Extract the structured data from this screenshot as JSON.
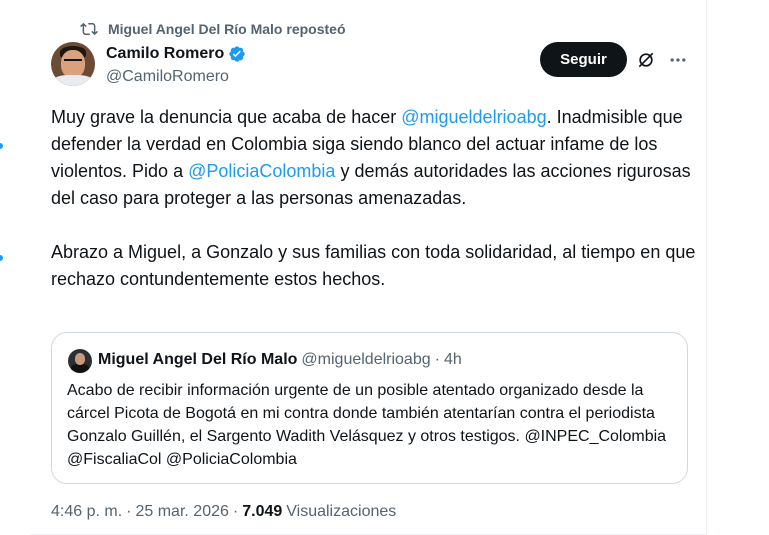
{
  "repost": {
    "text": "Miguel Angel Del Río Malo reposteó",
    "icon": "repost-icon"
  },
  "author": {
    "name": "Camilo Romero",
    "handle": "@CamiloRomero",
    "verified": true
  },
  "actions": {
    "follow_label": "Seguir",
    "grok_icon": "grok-icon",
    "more_icon": "more-icon"
  },
  "tweet": {
    "p1_a": "Muy grave la denuncia que acaba de hacer ",
    "p1_mention1": "@migueldelrioabg",
    "p1_b": ". Inadmisible que defender la verdad en Colombia siga siendo blanco del actuar infame de los violentos. Pido a ",
    "p1_mention2": "@PoliciaColombia",
    "p1_c": " y demás autoridades las acciones rigurosas del caso para proteger a las personas amenazadas.",
    "p2": "Abrazo a Miguel, a Gonzalo y sus familias con toda solidaridad, al tiempo en que rechazo contundentemente estos hechos."
  },
  "quote": {
    "name": "Miguel Angel Del Río Malo",
    "handle": "@migueldelrioabg",
    "separator": "·",
    "time": "4h",
    "text": "Acabo de recibir información urgente de un posible atentado organizado desde la cárcel Picota de Bogotá en mi contra donde también atentarían contra el periodista Gonzalo Guillén, el Sargento Wadith Velásquez y otros testigos. @INPEC_Colombia @FiscaliaCol @PoliciaColombia"
  },
  "meta": {
    "time": "4:46 p. m.",
    "separator": "·",
    "date": "25 mar. 2026",
    "separator2": "·",
    "views_count": "7.049",
    "views_label": "Visualizaciones"
  },
  "colors": {
    "accent": "#1d9bf0",
    "text": "#0f1419",
    "secondary": "#536471",
    "border": "#cfd9de"
  }
}
